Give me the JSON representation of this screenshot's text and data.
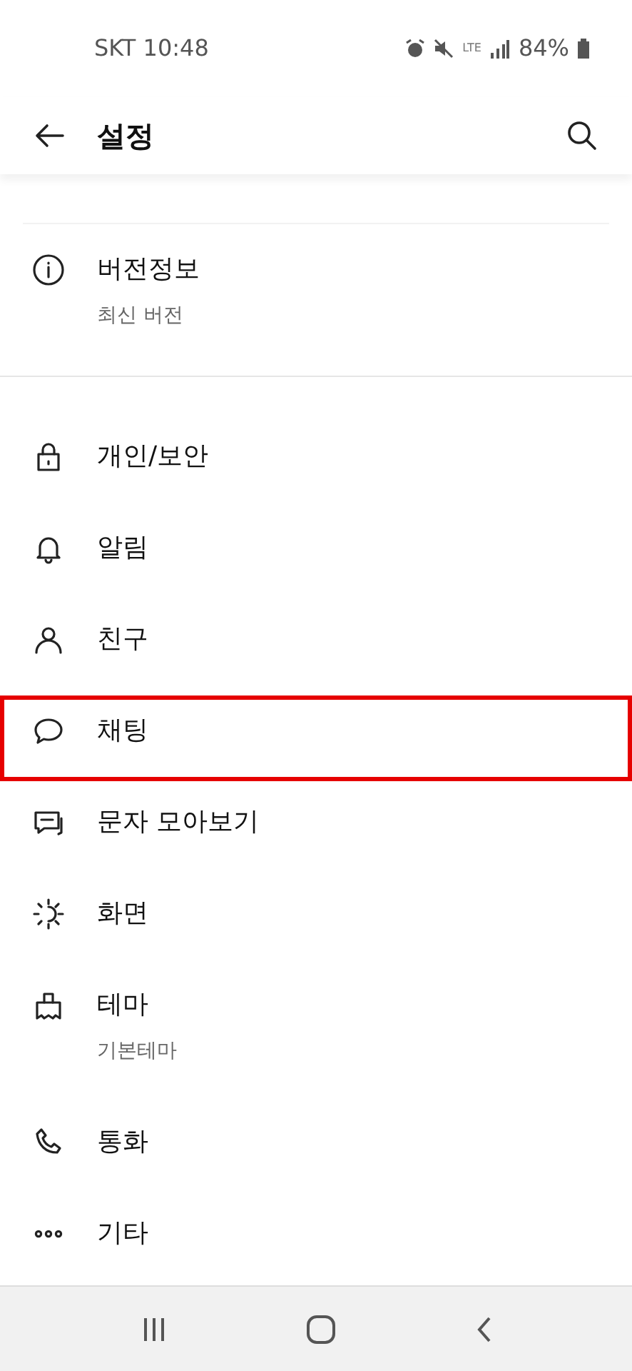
{
  "status_bar": {
    "carrier_time": "SKT 10:48",
    "network": "LTE",
    "battery": "84%"
  },
  "header": {
    "title": "설정"
  },
  "version": {
    "title": "버전정보",
    "subtitle": "최신 버전"
  },
  "items": [
    {
      "label": "개인/보안",
      "highlighted": false
    },
    {
      "label": "알림",
      "highlighted": false
    },
    {
      "label": "친구",
      "highlighted": false
    },
    {
      "label": "채팅",
      "highlighted": true
    },
    {
      "label": "문자 모아보기",
      "highlighted": false
    },
    {
      "label": "화면",
      "highlighted": false
    },
    {
      "label": "테마",
      "subtitle": "기본테마",
      "highlighted": false
    },
    {
      "label": "통화",
      "highlighted": false
    },
    {
      "label": "기타",
      "highlighted": false
    }
  ]
}
